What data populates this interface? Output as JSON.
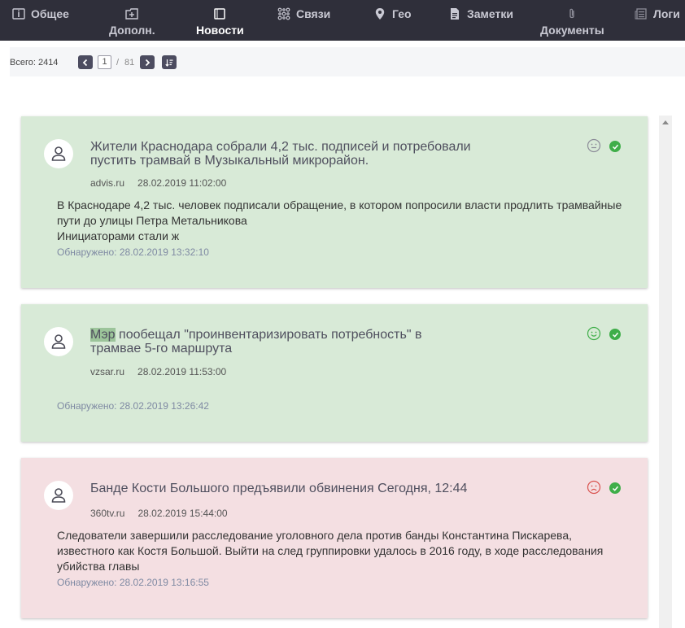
{
  "nav": {
    "tabs": [
      {
        "label": "Общее",
        "icon": "info-icon"
      },
      {
        "label": "Дополн.",
        "icon": "plus-box-icon"
      },
      {
        "label": "Новости",
        "icon": "square-icon",
        "active": true
      },
      {
        "label": "Связи",
        "icon": "network-icon"
      },
      {
        "label": "Гео",
        "icon": "map-pin-icon"
      },
      {
        "label": "Заметки",
        "icon": "note-icon"
      },
      {
        "label": "Документы",
        "icon": "paperclip-icon"
      },
      {
        "label": "Логи",
        "icon": "log-icon"
      }
    ]
  },
  "toolbar": {
    "total": "Всего: 2414",
    "page": "1",
    "separator": "/",
    "pages": "81"
  },
  "colors": {
    "nav_bg": "#2f2f3a",
    "positive_card": "#d8ead7",
    "negative_card": "#f4dfe2",
    "check_green": "#3fae49",
    "found_text": "#7f8aa3"
  },
  "news": [
    {
      "title": "Жители Краснодара собрали 4,2 тыс. подписей и потребовали пустить трамвай в Музыкальный микрорайон.",
      "source": "advis.ru",
      "date": "28.02.2019 11:02:00",
      "body": "В Краснодаре 4,2 тыс. человек подписали обращение, в котором попросили власти продлить трамвайные пути до улицы Петра Метальникова\nИнициаторами стали ж",
      "found": "Обнаружено: 28.02.2019 13:32:10",
      "sentiment": "neutral",
      "verified": true
    },
    {
      "title_highlight": "Мэр",
      "title_rest": " пообещал \"проинвентаризировать потребность\" в трамвае 5-го маршрута",
      "source": "vzsar.ru",
      "date": "28.02.2019 11:53:00",
      "found": "Обнаружено: 28.02.2019 13:26:42",
      "sentiment": "positive",
      "verified": true
    },
    {
      "title": "Банде Кости Большого предъявили обвинения Сегодня, 12:44",
      "source": "360tv.ru",
      "date": "28.02.2019 15:44:00",
      "body": "Следователи завершили расследование уголовного дела против банды Константина Пискарева, известного как Костя Большой. Выйти на след группировки удалось в 2016 году, в ходе расследования убийства главы",
      "found": "Обнаружено: 28.02.2019 13:16:55",
      "sentiment": "negative",
      "verified": true
    }
  ]
}
